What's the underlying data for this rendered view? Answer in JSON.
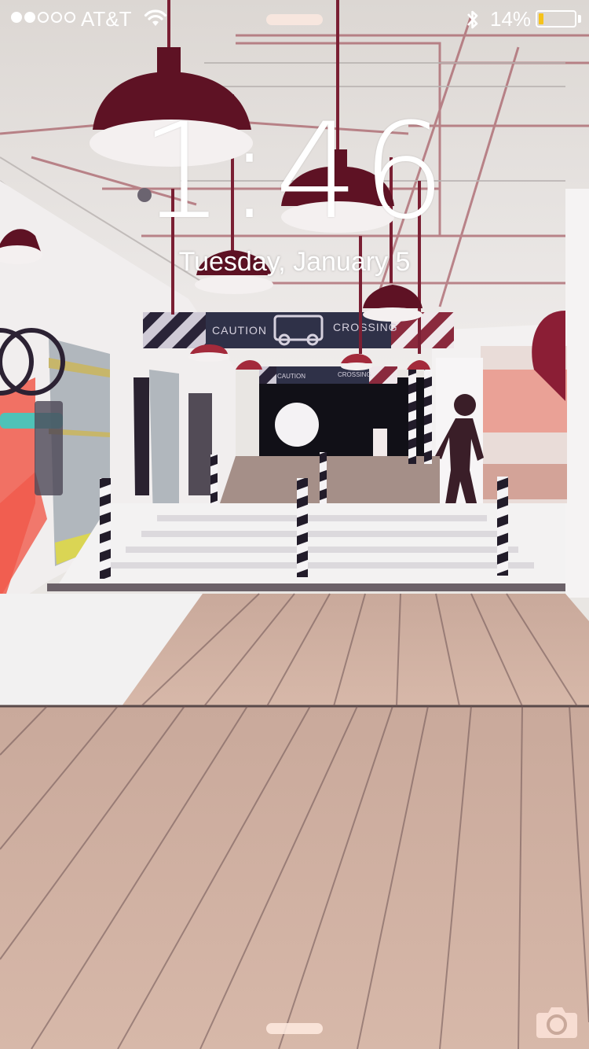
{
  "status_bar": {
    "signal_bars_filled": 2,
    "signal_bars_total": 5,
    "carrier": "AT&T",
    "battery_percent_text": "14%",
    "battery_level": 0.14,
    "battery_color": "#f5c21b"
  },
  "lock_screen": {
    "time": "1:46",
    "date": "Tuesday, January 5"
  },
  "wallpaper": {
    "signs": {
      "near": {
        "left": "CAUTION",
        "right": "CROSSING"
      },
      "far": {
        "left": "CAUTION",
        "right": "CROSSING"
      }
    }
  },
  "icons": {
    "wifi": "wifi-icon",
    "bluetooth": "bluetooth-icon",
    "camera": "camera-icon"
  }
}
